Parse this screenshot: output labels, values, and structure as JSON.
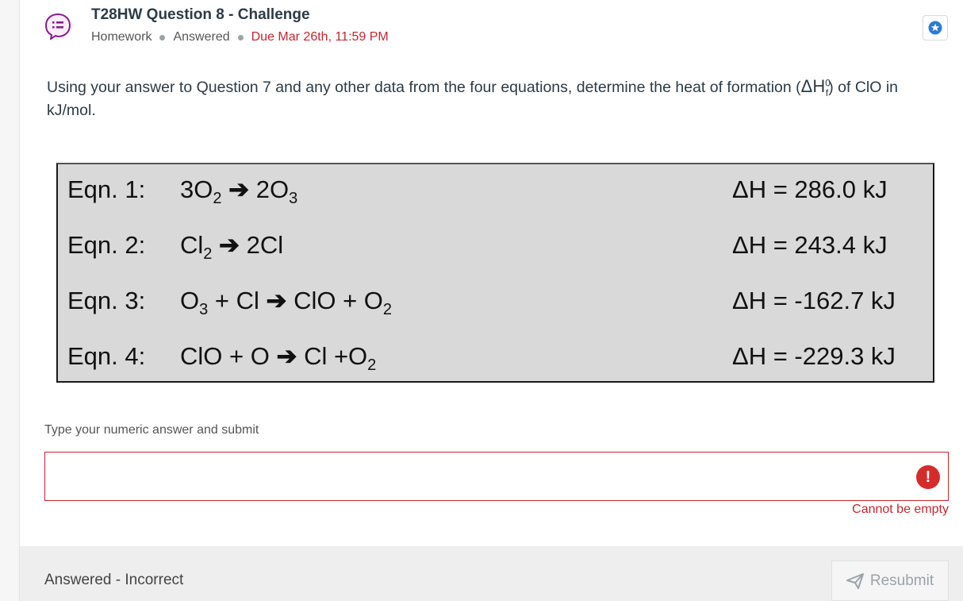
{
  "header": {
    "title": "T28HW Question 8 - Challenge",
    "type": "Homework",
    "status": "Answered",
    "due": "Due Mar 26th, 11:59 PM"
  },
  "question": {
    "text_before": "Using your answer to Question 7 and any other data from the four equations, determine the heat of formation (",
    "dh_symbol": "ΔH",
    "sup": "0",
    "sub": "f",
    "text_after": ") of ClO in kJ/mol."
  },
  "equations": [
    {
      "label": "Eqn. 1:",
      "reactants": "3O",
      "r_sub": "2",
      "products": "2O",
      "p_sub": "3",
      "dh": "ΔH = 286.0 kJ"
    },
    {
      "label": "Eqn. 2:",
      "reactants": "Cl",
      "r_sub": "2",
      "products": "2Cl",
      "p_sub": "",
      "dh": "ΔH = 243.4 kJ"
    },
    {
      "label": "Eqn. 3:",
      "r_a": "O",
      "r_a_sub": "3",
      "r_b": " + Cl ",
      "products": "ClO + O",
      "p_sub": "2",
      "dh": "ΔH = -162.7 kJ"
    },
    {
      "label": "Eqn. 4:",
      "reactants": "ClO + O ",
      "products": "Cl +O",
      "p_sub": "2",
      "dh": "ΔH = -229.3 kJ"
    }
  ],
  "arrow_glyph": "➔",
  "answer": {
    "label": "Type your numeric answer and submit",
    "value": "",
    "error": "Cannot be empty",
    "error_icon": "!"
  },
  "footer": {
    "status": "Answered - Incorrect",
    "resubmit_label": "Resubmit"
  },
  "colors": {
    "accent_purple": "#8a1c8f",
    "error_red": "#c4272e",
    "star_blue": "#2b7bd6"
  }
}
